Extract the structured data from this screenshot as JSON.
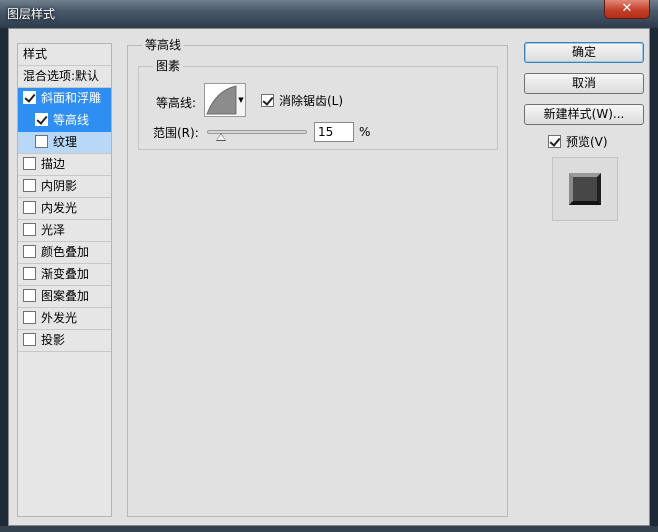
{
  "window": {
    "title": "图层样式",
    "close_glyph": "✕"
  },
  "style_list": {
    "header": "样式",
    "blending": "混合选项:默认",
    "items": [
      {
        "label": "斜面和浮雕",
        "checked": true,
        "state": "selected"
      },
      {
        "label": "等高线",
        "checked": true,
        "state": "selected-sub"
      },
      {
        "label": "纹理",
        "checked": false,
        "state": "sub"
      },
      {
        "label": "描边",
        "checked": false
      },
      {
        "label": "内阴影",
        "checked": false
      },
      {
        "label": "内发光",
        "checked": false
      },
      {
        "label": "光泽",
        "checked": false
      },
      {
        "label": "颜色叠加",
        "checked": false
      },
      {
        "label": "渐变叠加",
        "checked": false
      },
      {
        "label": "图案叠加",
        "checked": false
      },
      {
        "label": "外发光",
        "checked": false
      },
      {
        "label": "投影",
        "checked": false
      }
    ]
  },
  "contour_panel": {
    "group_title": "等高线",
    "elements_title": "图素",
    "contour_label": "等高线:",
    "antialias_label": "消除锯齿(L)",
    "antialias_checked": true,
    "range_label": "范围(R):",
    "range_value": "15",
    "range_unit": "%",
    "range_percent": 15
  },
  "buttons": {
    "ok": "确定",
    "cancel": "取消",
    "new_style": "新建样式(W)...",
    "preview_label": "预览(V)",
    "preview_checked": true
  },
  "colors": {
    "selection": "#2e8ef1",
    "sub_selection": "#b9d7f6",
    "panel": "#e1e1e1"
  }
}
